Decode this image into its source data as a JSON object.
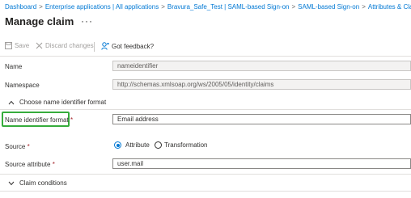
{
  "breadcrumb": {
    "items": [
      "Dashboard",
      "Enterprise applications | All applications",
      "Bravura_Safe_Test | SAML-based Sign-on",
      "SAML-based Sign-on",
      "Attributes & Claims"
    ],
    "separator": ">"
  },
  "page": {
    "title": "Manage claim",
    "more": "···"
  },
  "toolbar": {
    "save": "Save",
    "discard": "Discard changes",
    "feedback": "Got feedback?"
  },
  "form": {
    "name_label": "Name",
    "name_value": "nameidentifier",
    "namespace_label": "Namespace",
    "namespace_value": "http://schemas.xmlsoap.org/ws/2005/05/identity/claims",
    "choose_section": "Choose name identifier format",
    "nif_label": "Name identifier format",
    "nif_value": "Email address",
    "source_label": "Source",
    "source_options": [
      "Attribute",
      "Transformation"
    ],
    "source_selected": "Attribute",
    "source_attr_label": "Source attribute",
    "source_attr_value": "user.mail",
    "claim_conditions": "Claim conditions",
    "required_mark": "*"
  },
  "colors": {
    "link": "#0078d4",
    "highlight": "#36ac3c",
    "required": "#a4262c"
  }
}
